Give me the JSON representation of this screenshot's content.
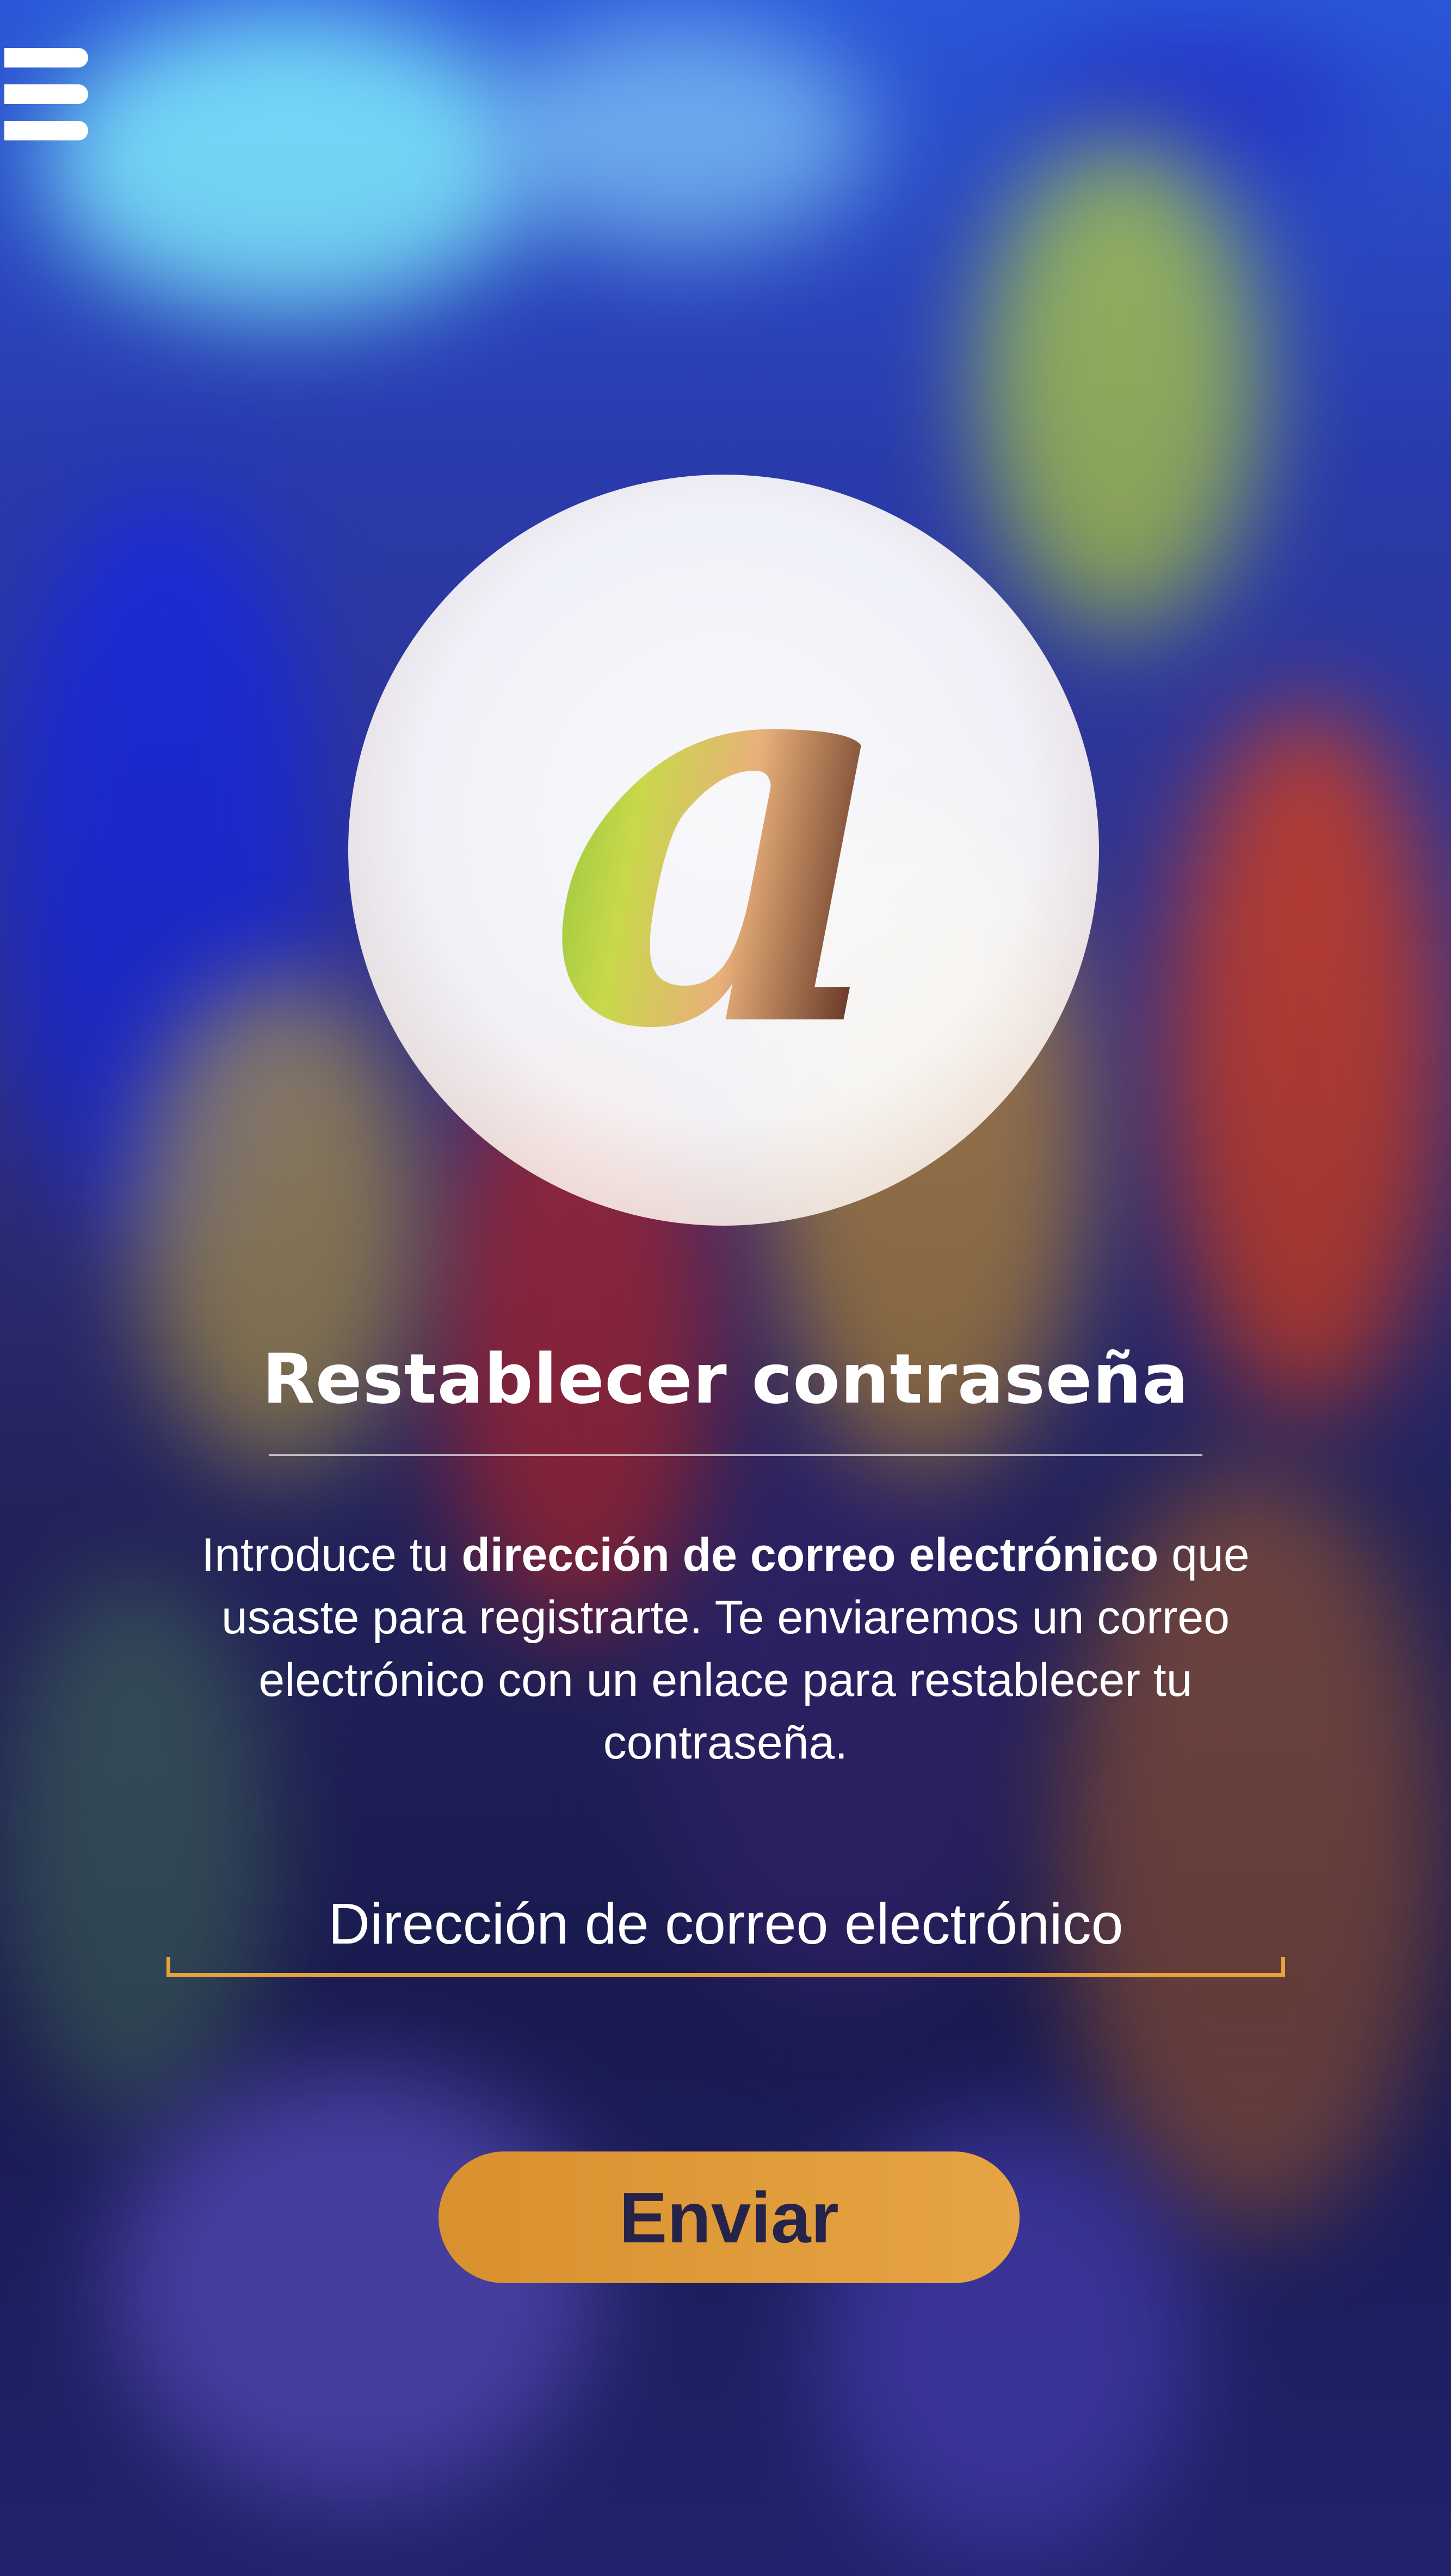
{
  "menu": {
    "icon": "hamburger-menu-icon"
  },
  "hero": {
    "icon": "at-sign-icon",
    "glyph": "a"
  },
  "title": "Restablecer contraseña",
  "description": {
    "prefix": "Introduce tu ",
    "bold": "dirección de correo electrónico",
    "suffix": " que usaste para registrarte. Te enviaremos un correo electrónico con un enlace para restablecer tu contraseña."
  },
  "email": {
    "placeholder": "Dirección de correo electrónico",
    "value": ""
  },
  "submit": {
    "label": "Enviar"
  },
  "colors": {
    "accent": "#e6a23c",
    "button_text": "#25234a",
    "text": "#ffffff"
  }
}
